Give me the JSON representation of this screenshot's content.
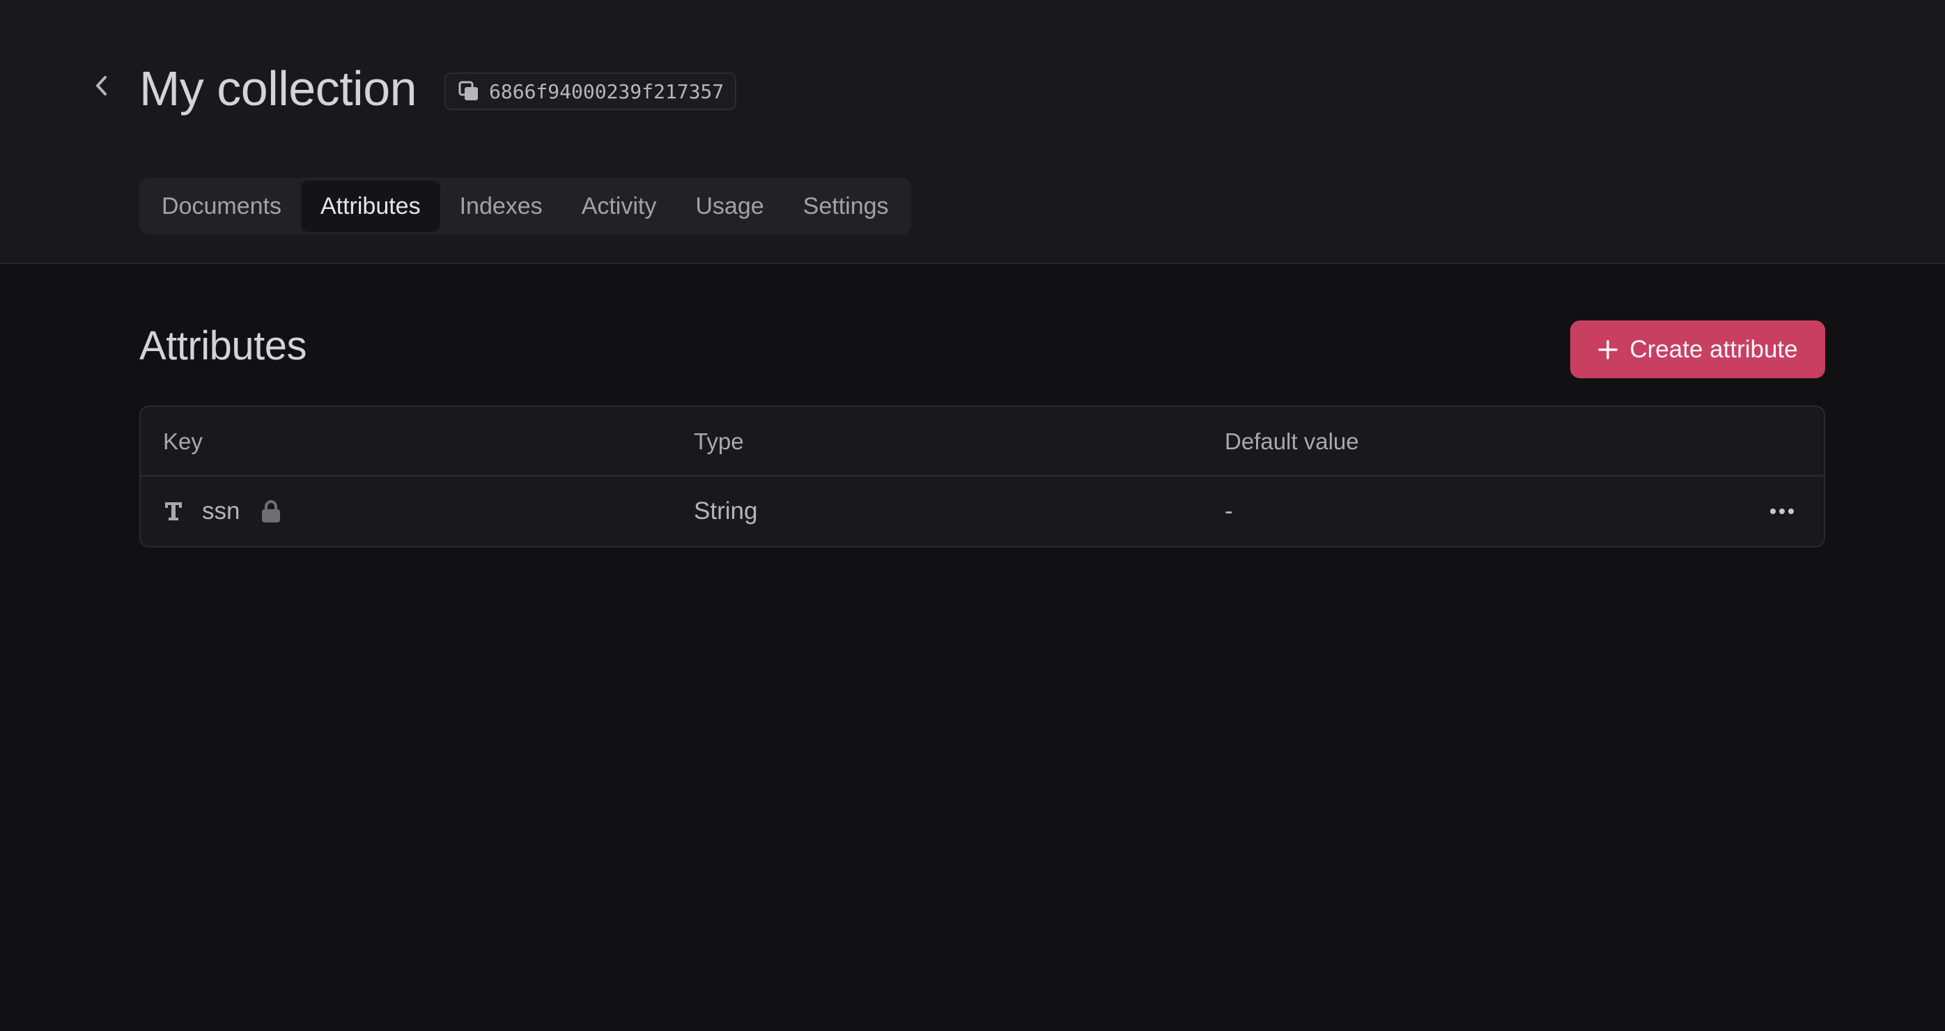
{
  "header": {
    "title": "My collection",
    "collection_id": "6866f94000239f217357"
  },
  "tabs": [
    {
      "label": "Documents",
      "active": false
    },
    {
      "label": "Attributes",
      "active": true
    },
    {
      "label": "Indexes",
      "active": false
    },
    {
      "label": "Activity",
      "active": false
    },
    {
      "label": "Usage",
      "active": false
    },
    {
      "label": "Settings",
      "active": false
    }
  ],
  "section": {
    "title": "Attributes",
    "create_label": "Create attribute"
  },
  "table": {
    "columns": [
      "Key",
      "Type",
      "Default value"
    ],
    "rows": [
      {
        "key": "ssn",
        "type_icon": "text-type-icon",
        "locked": true,
        "type": "String",
        "default_value": "-"
      }
    ]
  },
  "icons": {
    "back": "chevron-left-icon",
    "copy": "copy-icon",
    "plus": "plus-icon",
    "lock": "lock-icon",
    "more": "more-horizontal-icon"
  },
  "colors": {
    "accent": "#c93f62",
    "background": "#111113",
    "header_background": "#19191c"
  }
}
